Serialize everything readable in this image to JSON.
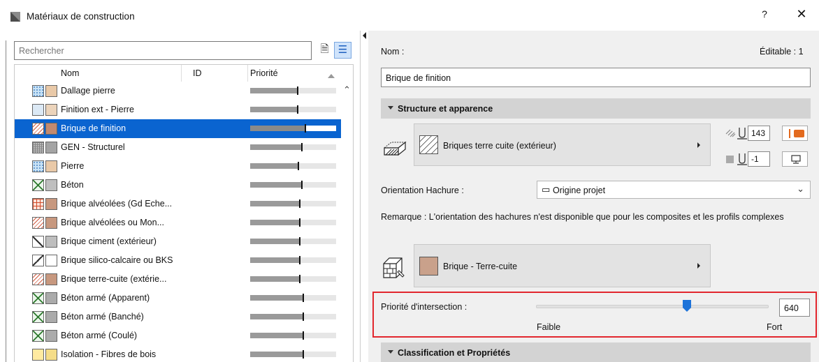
{
  "window": {
    "title": "Matériaux de construction",
    "help_label": "?",
    "close_label": "✕"
  },
  "left": {
    "search_placeholder": "Rechercher",
    "columns": [
      "Nom",
      "ID",
      "Priorité"
    ],
    "rows": [
      {
        "name": "Dallage pierre",
        "priority": 0.55,
        "p1": "pat-dots",
        "c2": "#e9c9a8"
      },
      {
        "name": "Finition ext - Pierre",
        "priority": 0.55,
        "p1": "pat-light",
        "c2": "#ecd4bb"
      },
      {
        "name": "Brique de finition",
        "priority": 0.64,
        "p1": "pat-hatch-red",
        "c2": "#c28a70",
        "selected": true
      },
      {
        "name": "GEN - Structurel",
        "priority": 0.6,
        "p1": "pat-grid",
        "c2": "#a4a4a4"
      },
      {
        "name": "Pierre",
        "priority": 0.56,
        "p1": "pat-dots",
        "c2": "#e9c9a8"
      },
      {
        "name": "Béton",
        "priority": 0.6,
        "p1": "pat-cross",
        "c2": "#bfbfbf"
      },
      {
        "name": "Brique alvéolées (Gd Eche...",
        "priority": 0.58,
        "p1": "pat-brickred",
        "c2": "#c7987f"
      },
      {
        "name": "Brique alvéolées ou Mon...",
        "priority": 0.58,
        "p1": "pat-hatch-red",
        "c2": "#c7987f"
      },
      {
        "name": "Brique ciment (extérieur)",
        "priority": 0.58,
        "p1": "pat-diag1",
        "c2": "#bebebe"
      },
      {
        "name": "Brique silico-calcaire ou BKS",
        "priority": 0.58,
        "p1": "pat-diag2",
        "c2": "#ffffff"
      },
      {
        "name": "Brique terre-cuite (extérie...",
        "priority": 0.58,
        "p1": "pat-hatch-red",
        "c2": "#c7987f"
      },
      {
        "name": "Béton armé (Apparent)",
        "priority": 0.62,
        "p1": "pat-cross",
        "c2": "#ababab"
      },
      {
        "name": "Béton armé (Banché)",
        "priority": 0.62,
        "p1": "pat-cross",
        "c2": "#ababab"
      },
      {
        "name": "Béton armé (Coulé)",
        "priority": 0.62,
        "p1": "pat-cross",
        "c2": "#ababab"
      },
      {
        "name": "Isolation - Fibres de bois",
        "priority": 0.62,
        "p1": "pat-yellow",
        "c2": "#f5dd88"
      }
    ]
  },
  "right": {
    "name_label": "Nom :",
    "editable_label": "Éditable : 1",
    "name_value": "Brique de finition",
    "section1_title": "Structure et apparence",
    "hatch_name": "Briques terre cuite (extérieur)",
    "pen1_value": "143",
    "pen2_value": "-1",
    "orientation_label": "Orientation Hachure :",
    "orientation_value": "Origine projet",
    "remark": "Remarque : L'orientation des hachures n'est disponible que pour les composites et les profils complexes",
    "surface_name": "Brique - Terre-cuite",
    "priority_label": "Priorité d'intersection :",
    "priority_value": "640",
    "low_label": "Faible",
    "high_label": "Fort",
    "section2_title": "Classification et Propriétés"
  },
  "colors": {
    "selection": "#0a64d0",
    "highlight_border": "#e2262d",
    "accent_orange": "#e36a1e",
    "slider_thumb": "#1d73d9"
  }
}
